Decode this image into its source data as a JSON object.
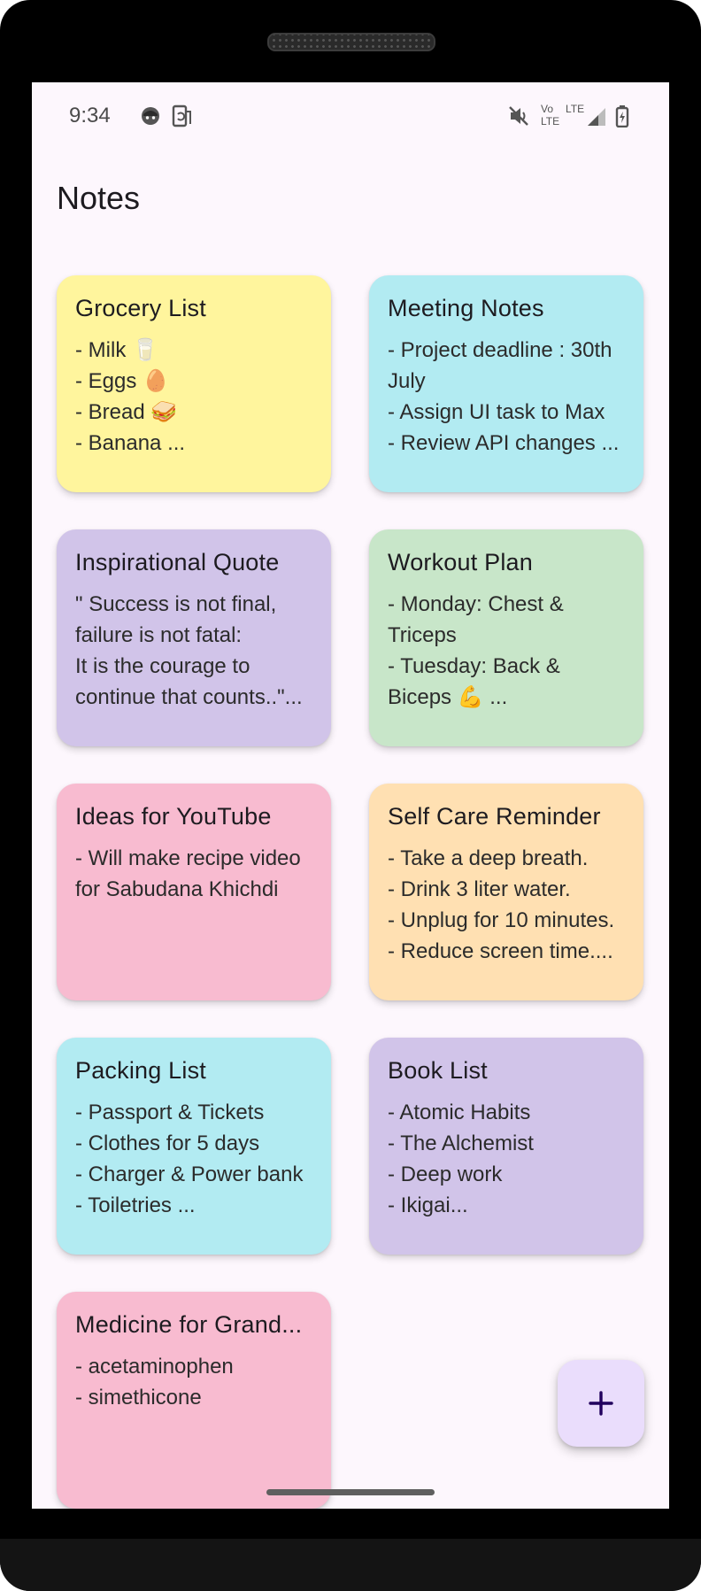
{
  "status_bar": {
    "time": "9:34",
    "left_icons": [
      "face-notification-icon",
      "phone-rotate-icon"
    ],
    "right_icons": [
      "mute-icon",
      "volte-lte-icon",
      "signal-icon",
      "battery-charging-icon"
    ],
    "volte_label": "Vo",
    "lte_label": "LTE",
    "lte_label_2": "LTE"
  },
  "header": {
    "title": "Notes"
  },
  "notes": [
    {
      "title": "Grocery List",
      "body": "- Milk 🥛\n- Eggs 🥚\n- Bread 🥪\n- Banana ...",
      "color": "#fff59d"
    },
    {
      "title": "Meeting Notes",
      "body": "- Project deadline : 30th\nJuly\n- Assign UI task to Max\n- Review API changes ...",
      "color": "#b2ebf2"
    },
    {
      "title": "Inspirational Quote",
      "body": "\" Success is not final,\nfailure is not fatal:\nIt is the courage to\ncontinue that counts..\"...",
      "color": "#d1c4e9"
    },
    {
      "title": "Workout Plan",
      "body": "- Monday: Chest &\nTriceps\n- Tuesday: Back &\nBiceps 💪 ...",
      "color": "#c8e6c9"
    },
    {
      "title": "Ideas for YouTube",
      "body": "- Will make recipe video\nfor Sabudana Khichdi",
      "color": "#f8bbd0"
    },
    {
      "title": "Self Care Reminder",
      "body": "- Take a deep breath.\n- Drink 3 liter water.\n- Unplug for 10 minutes.\n- Reduce screen time....",
      "color": "#ffe0b2"
    },
    {
      "title": "Packing List",
      "body": "- Passport & Tickets\n- Clothes for 5 days\n- Charger & Power bank\n- Toiletries ...",
      "color": "#b2ebf2"
    },
    {
      "title": "Book List",
      "body": "- Atomic Habits\n- The Alchemist\n- Deep work\n- Ikigai...",
      "color": "#d1c4e9"
    },
    {
      "title": "Medicine for Grand...",
      "body": "- acetaminophen\n- simethicone",
      "color": "#f8bbd0"
    }
  ],
  "fab": {
    "icon": "plus-icon",
    "color": "#eaddfc",
    "icon_color": "#21005d"
  },
  "colors": {
    "background": "#fdf7fd",
    "text": "#1d1b20"
  }
}
